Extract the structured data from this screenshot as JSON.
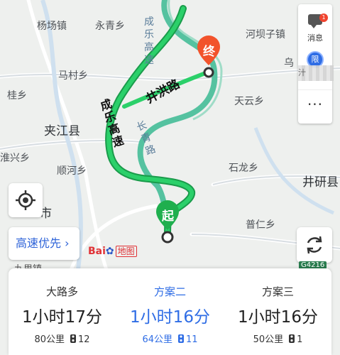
{
  "map": {
    "places": {
      "yangchang": "杨场镇",
      "yongqing": "永青乡",
      "hebazi": "河坝子镇",
      "wu": "乌",
      "mazhen": "马村乡",
      "gui": "桂乡",
      "tianyun": "天云乡",
      "jiajiang": "夹江县",
      "huaixiang": "淮兴乡",
      "shunzhen": "顺河乡",
      "shilong": "石龙乡",
      "jingyan": "井研县",
      "shi": "市",
      "puren": "普仁乡",
      "jiuli": "九里镇"
    },
    "roads": {
      "chengle_light": "成乐高速",
      "jinghong": "井洪路",
      "chengle_bold": "成乐高速",
      "changqing": "长青路"
    },
    "markers": {
      "start": "起",
      "end": "终"
    },
    "colors": {
      "route_selected": "#1fb85a",
      "route_alt": "#55c2a0",
      "marker_start": "#1faf4e",
      "marker_end": "#f2532b"
    }
  },
  "controls": {
    "messages_label": "消息",
    "messages_badge": "1",
    "limit_icon_text": "限",
    "limit_sub": "汁",
    "more_icon": "···",
    "route_pref": "高速优先 ›",
    "baidu_brand": "Bai",
    "baidu_suffix": "地图",
    "highway_shield": "G4216"
  },
  "routes": [
    {
      "name": "大路多",
      "time": "1小时17分",
      "distance": "80公里",
      "lights": "12",
      "selected": false
    },
    {
      "name": "方案二",
      "time": "1小时16分",
      "distance": "64公里",
      "lights": "11",
      "selected": true
    },
    {
      "name": "方案三",
      "time": "1小时16分",
      "distance": "50公里",
      "lights": "1",
      "selected": false
    }
  ]
}
